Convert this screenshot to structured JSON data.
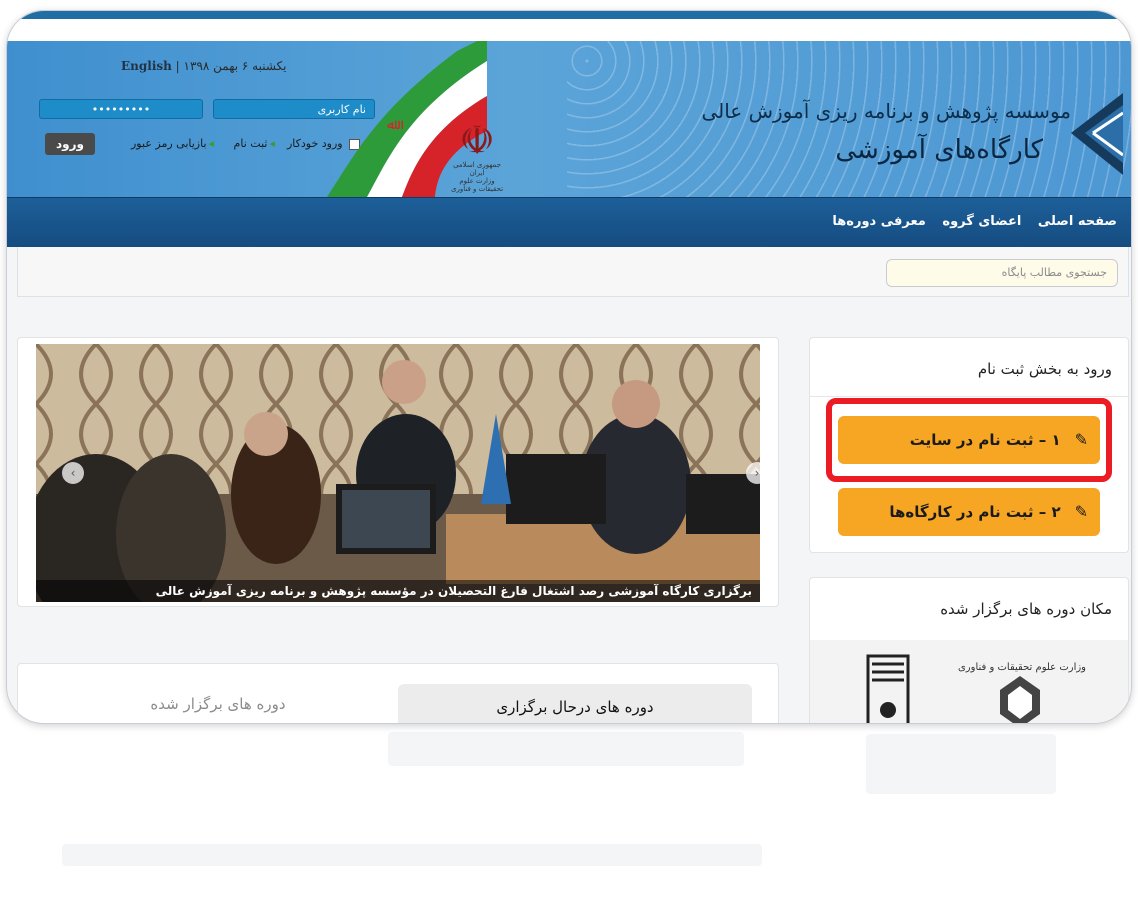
{
  "header": {
    "date": "یکشنبه ۶ بهمن ۱۳۹۸",
    "english_link": "English",
    "username_placeholder": "نام کاربری",
    "password_value": "•••••••••",
    "login_label": "ورود",
    "remember_label": "ورود خودکار",
    "signup_link": "ثبت نام",
    "recover_link": "بازیابی رمز عبور",
    "emblem_caption": "جمهوری اسلامی ایران",
    "ministry_caption": "وزارت علوم تحقیقات و فناوری",
    "institute_title": "موسسه پژوهش و برنامه ریزی آموزش عالی",
    "site_title": "کارگاه‌های آموزشی"
  },
  "nav": {
    "items": [
      "صفحه اصلی",
      "اعضای گروه",
      "معرفی دوره‌ها"
    ]
  },
  "search": {
    "placeholder": "جستجوی مطالب پایگاه"
  },
  "slider": {
    "caption": "برگزاری کارگاه آموزشی رصد اشتغال فارغ التحصیلان در مؤسسه پژوهش و برنامه ریزی آموزش عالی",
    "prev_icon": "chevron-left-icon",
    "next_icon": "chevron-right-icon"
  },
  "registration": {
    "title": "ورود به بخش ثبت نام",
    "btn1": "۱ – ثبت نام در سایت",
    "btn2": "۲ – ثبت نام در کارگاه‌ها",
    "btn_color": "#f6a623",
    "highlight_color": "#ec1c24"
  },
  "locations": {
    "title": "مکان دوره های برگزار شده"
  },
  "tabs": {
    "active": "دوره های درحال برگزاری",
    "inactive": "دوره های برگزار شده"
  }
}
